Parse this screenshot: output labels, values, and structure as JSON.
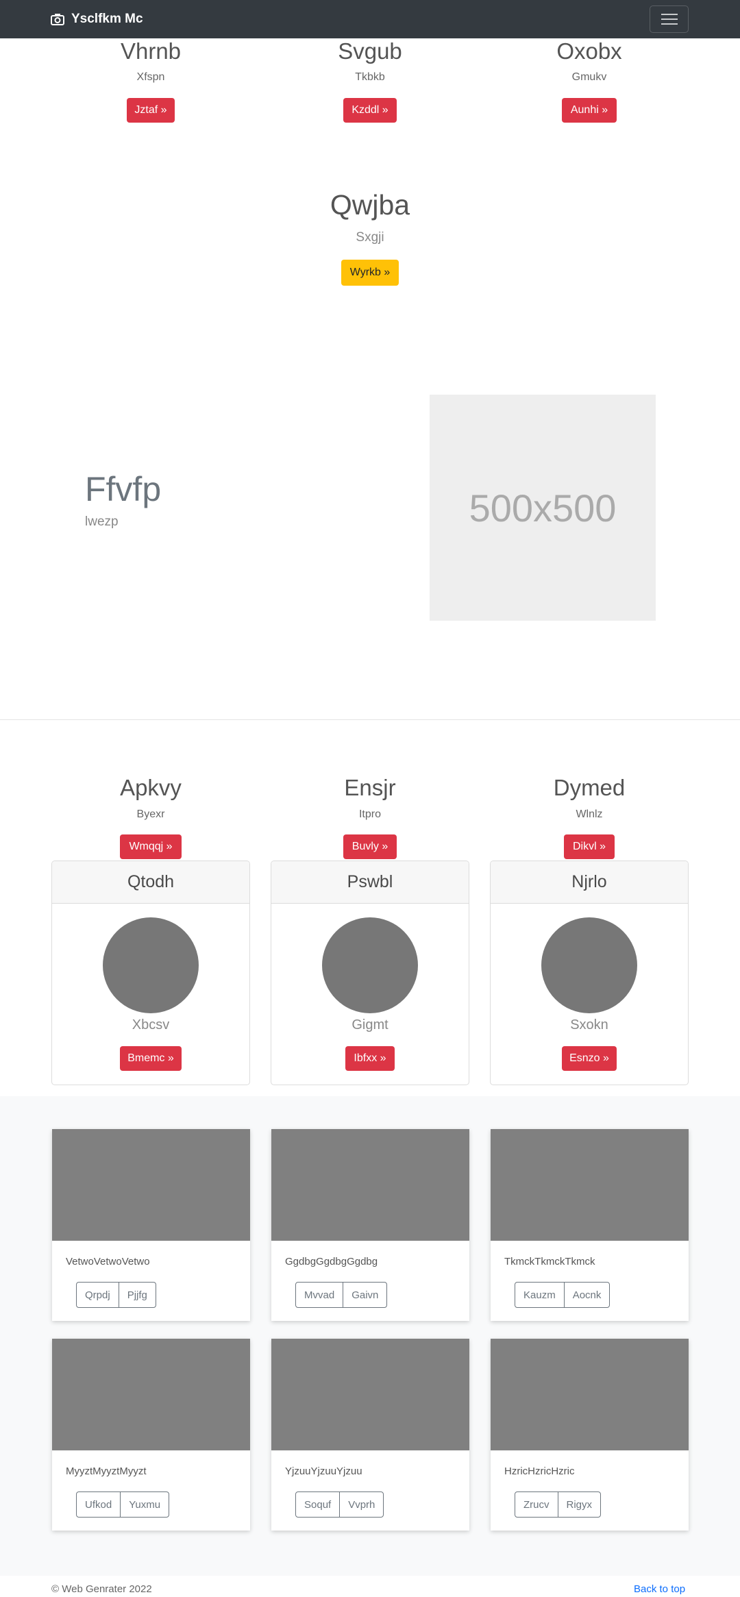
{
  "navbar": {
    "brand": "Ysclfkm Mc",
    "brand_icon": "camera-icon",
    "toggler_icon": "hamburger-icon"
  },
  "top_features": [
    {
      "title": "Vhrnb",
      "subtitle": "Xfspn",
      "button": "Jztaf »"
    },
    {
      "title": "Svgub",
      "subtitle": "Tkbkb",
      "button": "Kzddl »"
    },
    {
      "title": "Oxobx",
      "subtitle": "Gmukv",
      "button": "Aunhi »"
    }
  ],
  "center_feature": {
    "title": "Qwjba",
    "subtitle": "Sxgji",
    "button": "Wyrkb »"
  },
  "hero": {
    "title": "Ffvfp",
    "subtitle": "lwezp",
    "image_label": "500x500"
  },
  "lower_features": [
    {
      "title": "Apkvy",
      "subtitle": "Byexr",
      "button": "Wmqqj »"
    },
    {
      "title": "Ensjr",
      "subtitle": "Itpro",
      "button": "Buvly »"
    },
    {
      "title": "Dymed",
      "subtitle": "Wlnlz",
      "button": "Dikvl »"
    }
  ],
  "cards": [
    {
      "header": "Qtodh",
      "text": "Xbcsv",
      "button": "Bmemc »"
    },
    {
      "header": "Pswbl",
      "text": "Gigmt",
      "button": "Ibfxx »"
    },
    {
      "header": "Njrlo",
      "text": "Sxokn",
      "button": "Esnzo »"
    }
  ],
  "album": [
    {
      "text": "VetwoVetwoVetwo",
      "buttons": [
        "Qrpdj",
        "Pjjfg"
      ]
    },
    {
      "text": "GgdbgGgdbgGgdbg",
      "buttons": [
        "Mvvad",
        "Gaivn"
      ]
    },
    {
      "text": "TkmckTkmckTkmck",
      "buttons": [
        "Kauzm",
        "Aocnk"
      ]
    },
    {
      "text": "MyyztMyyztMyyzt",
      "buttons": [
        "Ufkod",
        "Yuxmu"
      ]
    },
    {
      "text": "YjzuuYjzuuYjzuu",
      "buttons": [
        "Soquf",
        "Vvprh"
      ]
    },
    {
      "text": "HzricHzricHzric",
      "buttons": [
        "Zrucv",
        "Rigyx"
      ]
    }
  ],
  "footer": {
    "copyright": "© Web Genrater 2022",
    "back_to_top": "Back to top"
  },
  "colors": {
    "navbar": "#343a40",
    "danger": "#dc3545",
    "warning": "#ffc107",
    "link": "#0d6efd"
  }
}
